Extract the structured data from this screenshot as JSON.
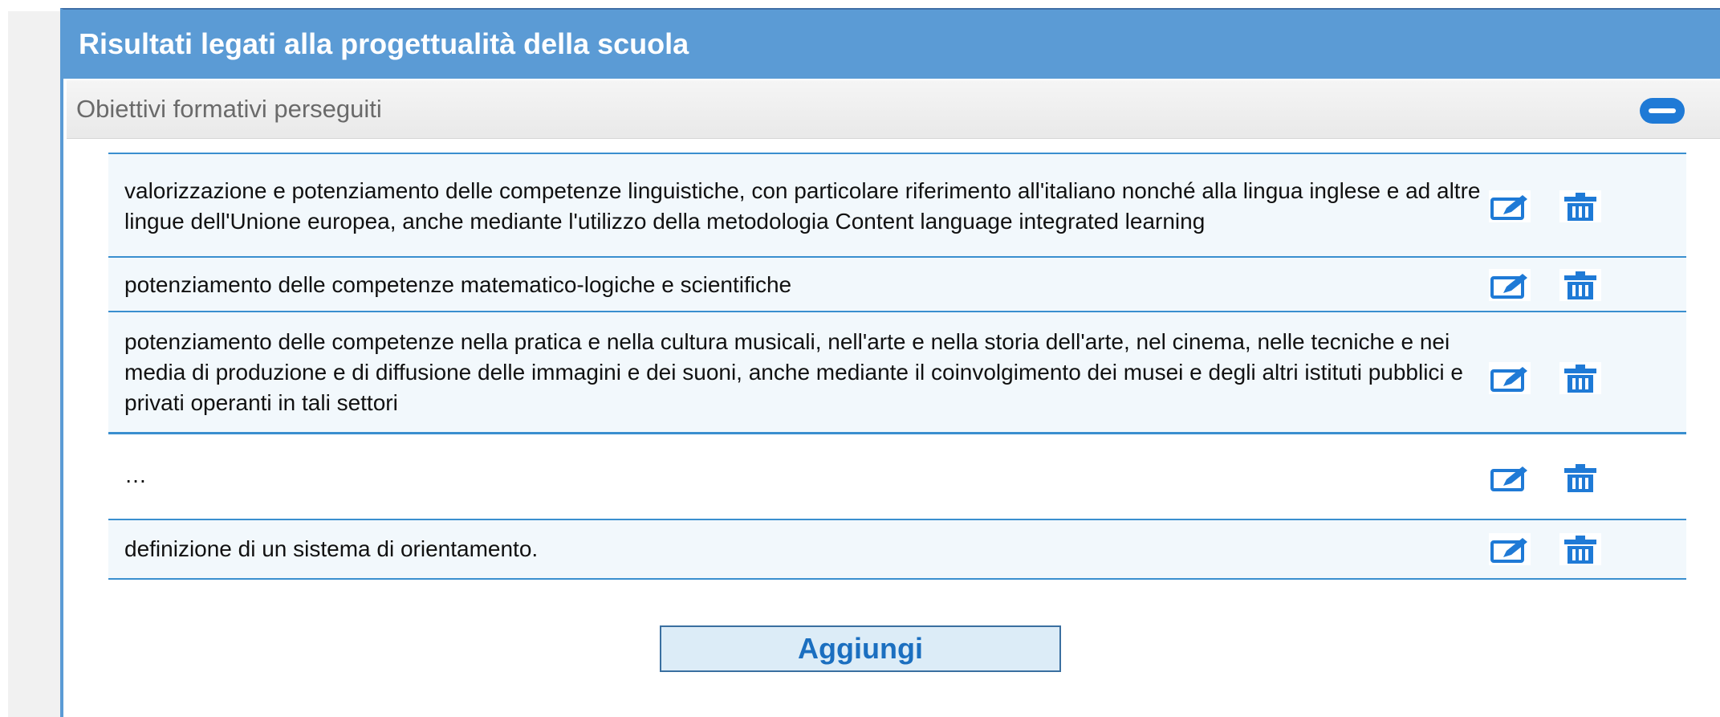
{
  "panel": {
    "title": "Risultati legati alla progettualità della scuola",
    "subheader": "Obiettivi formativi perseguiti",
    "collapse_icon": "collapse-minus-icon"
  },
  "objectives": [
    {
      "text": "valorizzazione e potenziamento delle competenze linguistiche, con particolare riferimento all'italiano nonché alla lingua inglese e ad altre lingue dell'Unione europea, anche mediante l'utilizzo della metodologia Content language integrated learning"
    },
    {
      "text": "potenziamento delle competenze matematico-logiche e scientifiche"
    },
    {
      "text": "potenziamento delle competenze nella pratica e nella cultura musicali, nell'arte e nella storia dell'arte, nel cinema, nelle tecniche e nei media di produzione e di diffusione delle immagini e dei suoni, anche mediante il coinvolgimento dei musei e degli altri istituti pubblici e privati operanti in tali settori"
    },
    {
      "text": "…"
    },
    {
      "text": "definizione di un sistema di orientamento."
    }
  ],
  "row_actions": {
    "edit_icon": "edit-icon",
    "delete_icon": "trash-icon"
  },
  "add_button_label": "Aggiungi",
  "colors": {
    "header": "#5b9bd5",
    "accent": "#1f7ad6",
    "row_border": "#3a8fcf",
    "row_bg": "#f2f8fc",
    "button_bg": "#dcecf7"
  }
}
